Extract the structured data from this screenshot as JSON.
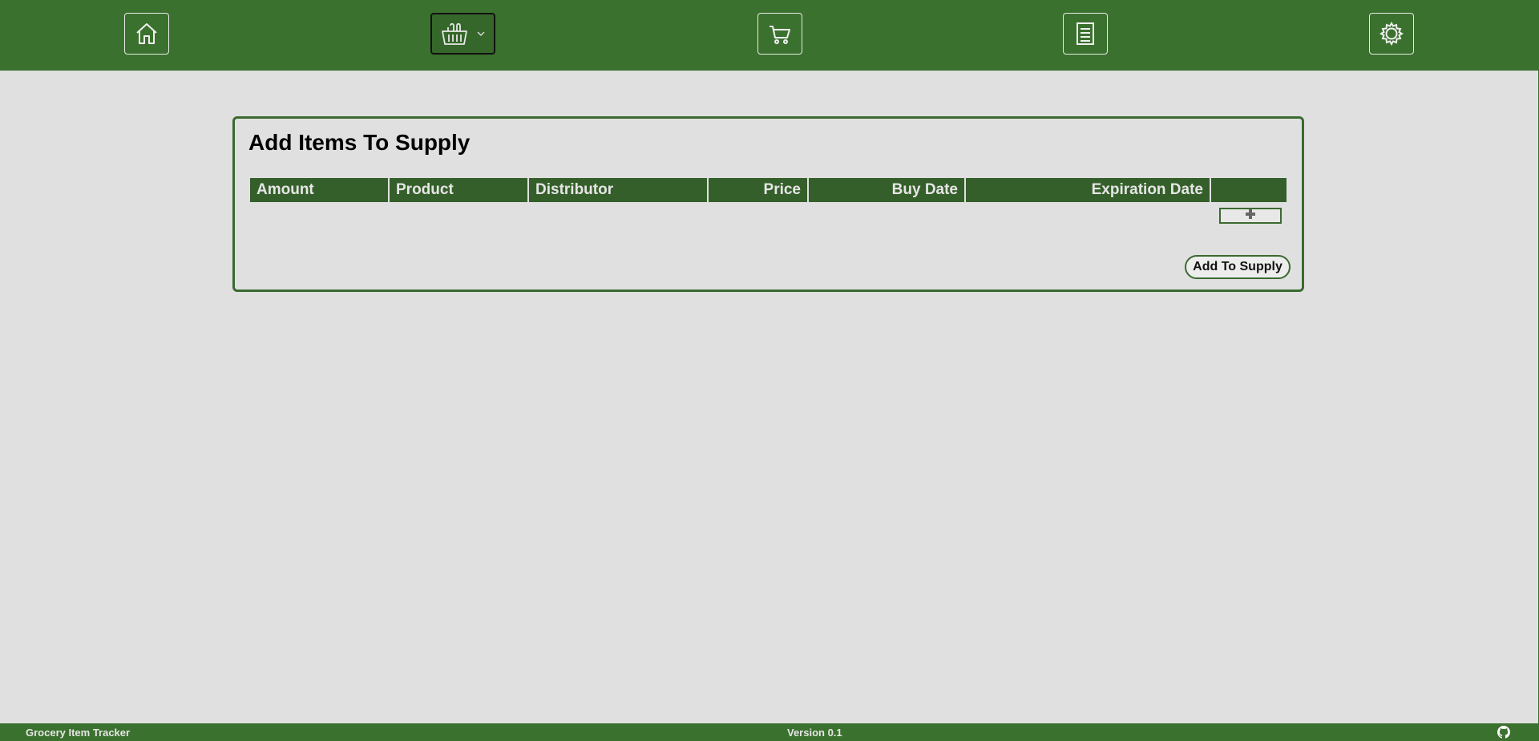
{
  "nav": {
    "items": [
      {
        "icon": "home-icon",
        "active": false
      },
      {
        "icon": "basket-icon",
        "active": true,
        "has_dropdown": true
      },
      {
        "icon": "cart-icon",
        "active": false
      },
      {
        "icon": "list-icon",
        "active": false
      },
      {
        "icon": "gear-icon",
        "active": false
      }
    ]
  },
  "card": {
    "title": "Add Items To Supply",
    "columns": [
      "Amount",
      "Product",
      "Distributor",
      "Price",
      "Buy Date",
      "Expiration Date",
      ""
    ],
    "add_row_icon": "plus-icon",
    "submit_label": "Add To Supply"
  },
  "footer": {
    "app_name": "Grocery Item Tracker",
    "version": "Version 0.1",
    "link_icon": "github-icon"
  },
  "colors": {
    "header_green": "#3b712e",
    "table_header_green": "#355f2a",
    "background": "#e0e0e0"
  }
}
